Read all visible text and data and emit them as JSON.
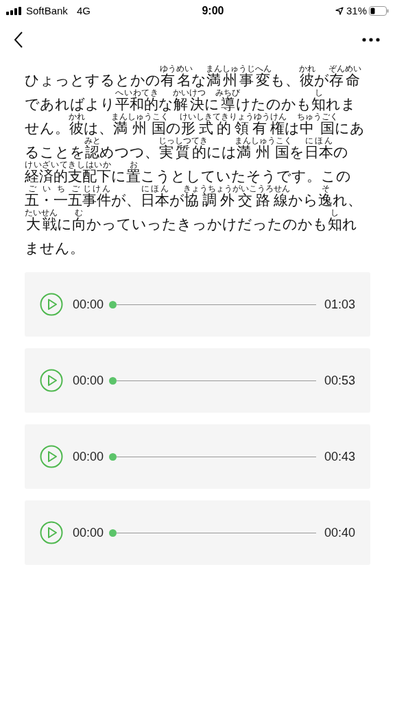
{
  "status_bar": {
    "carrier": "SoftBank",
    "network": "4G",
    "time": "9:00",
    "battery": "31%"
  },
  "paragraph": [
    {
      "text": "ひょっとするとかの"
    },
    {
      "text": "有名",
      "ruby": "ゆうめい"
    },
    {
      "text": "な"
    },
    {
      "text": "満州事変",
      "ruby": "まんしゅうじへん"
    },
    {
      "text": "も、"
    },
    {
      "text": "彼",
      "ruby": "かれ"
    },
    {
      "text": "が"
    },
    {
      "text": "存命",
      "ruby": "ぞんめい"
    },
    {
      "text": "であればより"
    },
    {
      "text": "平和的",
      "ruby": "へいわてき"
    },
    {
      "text": "な"
    },
    {
      "text": "解決",
      "ruby": "かいけつ"
    },
    {
      "text": "に"
    },
    {
      "text": "導",
      "ruby": "みちび"
    },
    {
      "text": "けたのかも"
    },
    {
      "text": "知",
      "ruby": "し"
    },
    {
      "text": "れません。"
    },
    {
      "text": "彼",
      "ruby": "かれ"
    },
    {
      "text": "は、"
    },
    {
      "text": "満州国",
      "ruby": "まんしゅうこく"
    },
    {
      "text": "の"
    },
    {
      "text": "形式的領有権",
      "ruby": "けいしきてきりょうゆうけん"
    },
    {
      "text": "は"
    },
    {
      "text": "中国",
      "ruby": "ちゅうごく"
    },
    {
      "text": "にあることを"
    },
    {
      "text": "認",
      "ruby": "みと"
    },
    {
      "text": "めつつ、"
    },
    {
      "text": "実質的",
      "ruby": "じっしつてき"
    },
    {
      "text": "には"
    },
    {
      "text": "満州国",
      "ruby": "まんしゅうこく"
    },
    {
      "text": "を"
    },
    {
      "text": "日本",
      "ruby": "にほん"
    },
    {
      "text": "の"
    },
    {
      "text": "経済的支配下",
      "ruby": "けいざいてきしはいか"
    },
    {
      "text": "に"
    },
    {
      "text": "置",
      "ruby": "お"
    },
    {
      "text": "こうとしていたそうです。この"
    },
    {
      "text": "五・一五",
      "ruby": "ごいちご"
    },
    {
      "text": "事件",
      "ruby": "じけん"
    },
    {
      "text": "が、"
    },
    {
      "text": "日本",
      "ruby": "にほん"
    },
    {
      "text": "が"
    },
    {
      "text": "協調外交路線",
      "ruby": "きょうちょうがいこうろせん"
    },
    {
      "text": "から"
    },
    {
      "text": "逸",
      "ruby": "そ"
    },
    {
      "text": "れ、"
    },
    {
      "text": "大戦",
      "ruby": "たいせん"
    },
    {
      "text": "に"
    },
    {
      "text": "向",
      "ruby": "む"
    },
    {
      "text": "かっていったきっかけだったのかも"
    },
    {
      "text": "知",
      "ruby": "し"
    },
    {
      "text": "れません。"
    }
  ],
  "players": [
    {
      "current": "00:00",
      "duration": "01:03",
      "level": 0
    },
    {
      "current": "00:00",
      "duration": "00:53",
      "level": 0
    },
    {
      "current": "00:00",
      "duration": "00:43",
      "level": 0
    },
    {
      "current": "00:00",
      "duration": "00:40",
      "level": 0
    }
  ]
}
